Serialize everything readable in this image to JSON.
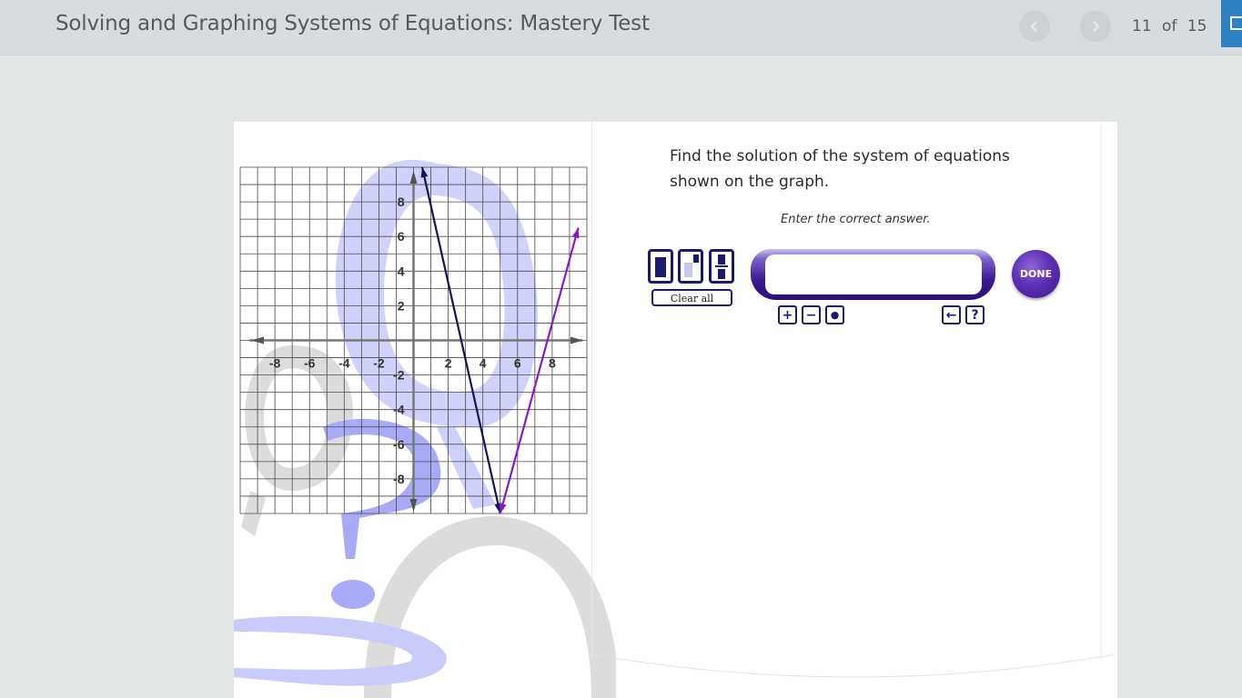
{
  "header": {
    "title": "Solving and Graphing Systems of Equations: Mastery Test",
    "page_current": "11",
    "page_of": "of",
    "page_total": "15"
  },
  "question": {
    "prompt": "Find the solution of the system of equations shown on the graph.",
    "instruction": "Enter the correct answer.",
    "answer_value": "",
    "clear_all_label": "Clear all",
    "done_label": "DONE"
  },
  "graph": {
    "x_ticks": [
      "-8",
      "-6",
      "-4",
      "-2",
      "2",
      "4",
      "6",
      "8"
    ],
    "y_ticks": [
      "8",
      "6",
      "4",
      "2",
      "-2",
      "-4",
      "-6",
      "-8"
    ],
    "line_1": {
      "color": "#14145a",
      "points": [
        [
          0.5,
          10
        ],
        [
          5,
          -10
        ]
      ]
    },
    "line_2": {
      "color": "#8a18c9",
      "points": [
        [
          5,
          -10
        ],
        [
          9.5,
          6.5
        ]
      ]
    }
  },
  "keypad": {
    "plus": "+",
    "minus": "−",
    "dot": "●",
    "back": "←",
    "help": "?"
  },
  "colors": {
    "accent_blue": "#2f82c4",
    "frame_purple": "#3d1a93"
  }
}
